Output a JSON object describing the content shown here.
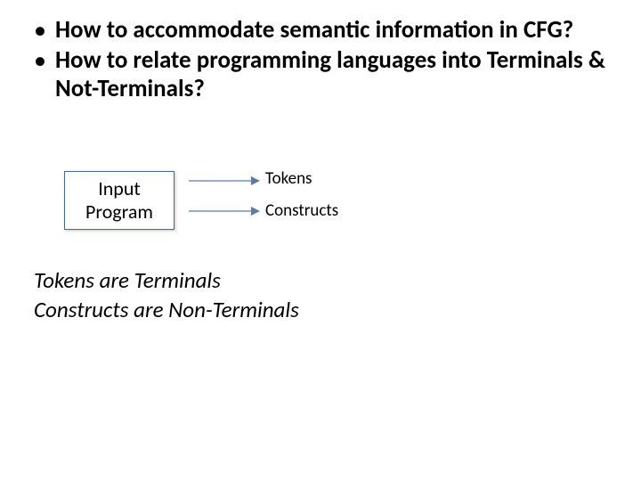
{
  "bullets": [
    "How to accommodate semantic information in CFG?",
    "How to relate programming languages into Terminals & Not-Terminals?"
  ],
  "diagram": {
    "box_label": "Input\nProgram",
    "arrows": [
      {
        "label": "Tokens"
      },
      {
        "label": "Constructs"
      }
    ]
  },
  "notes": [
    "Tokens are Terminals",
    "Constructs are Non-Terminals"
  ]
}
